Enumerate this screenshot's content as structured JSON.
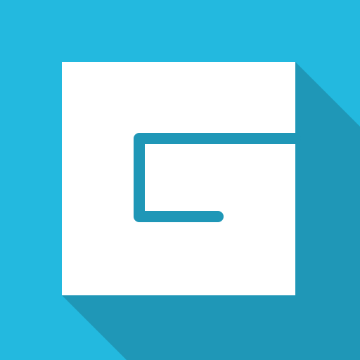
{
  "icon": {
    "name": "app-logo-icon",
    "colors": {
      "background": "#23B9DF",
      "long_shadow": "#1F97B7",
      "tile": "#FFFFFF",
      "glyph": "#1F97B7"
    }
  }
}
